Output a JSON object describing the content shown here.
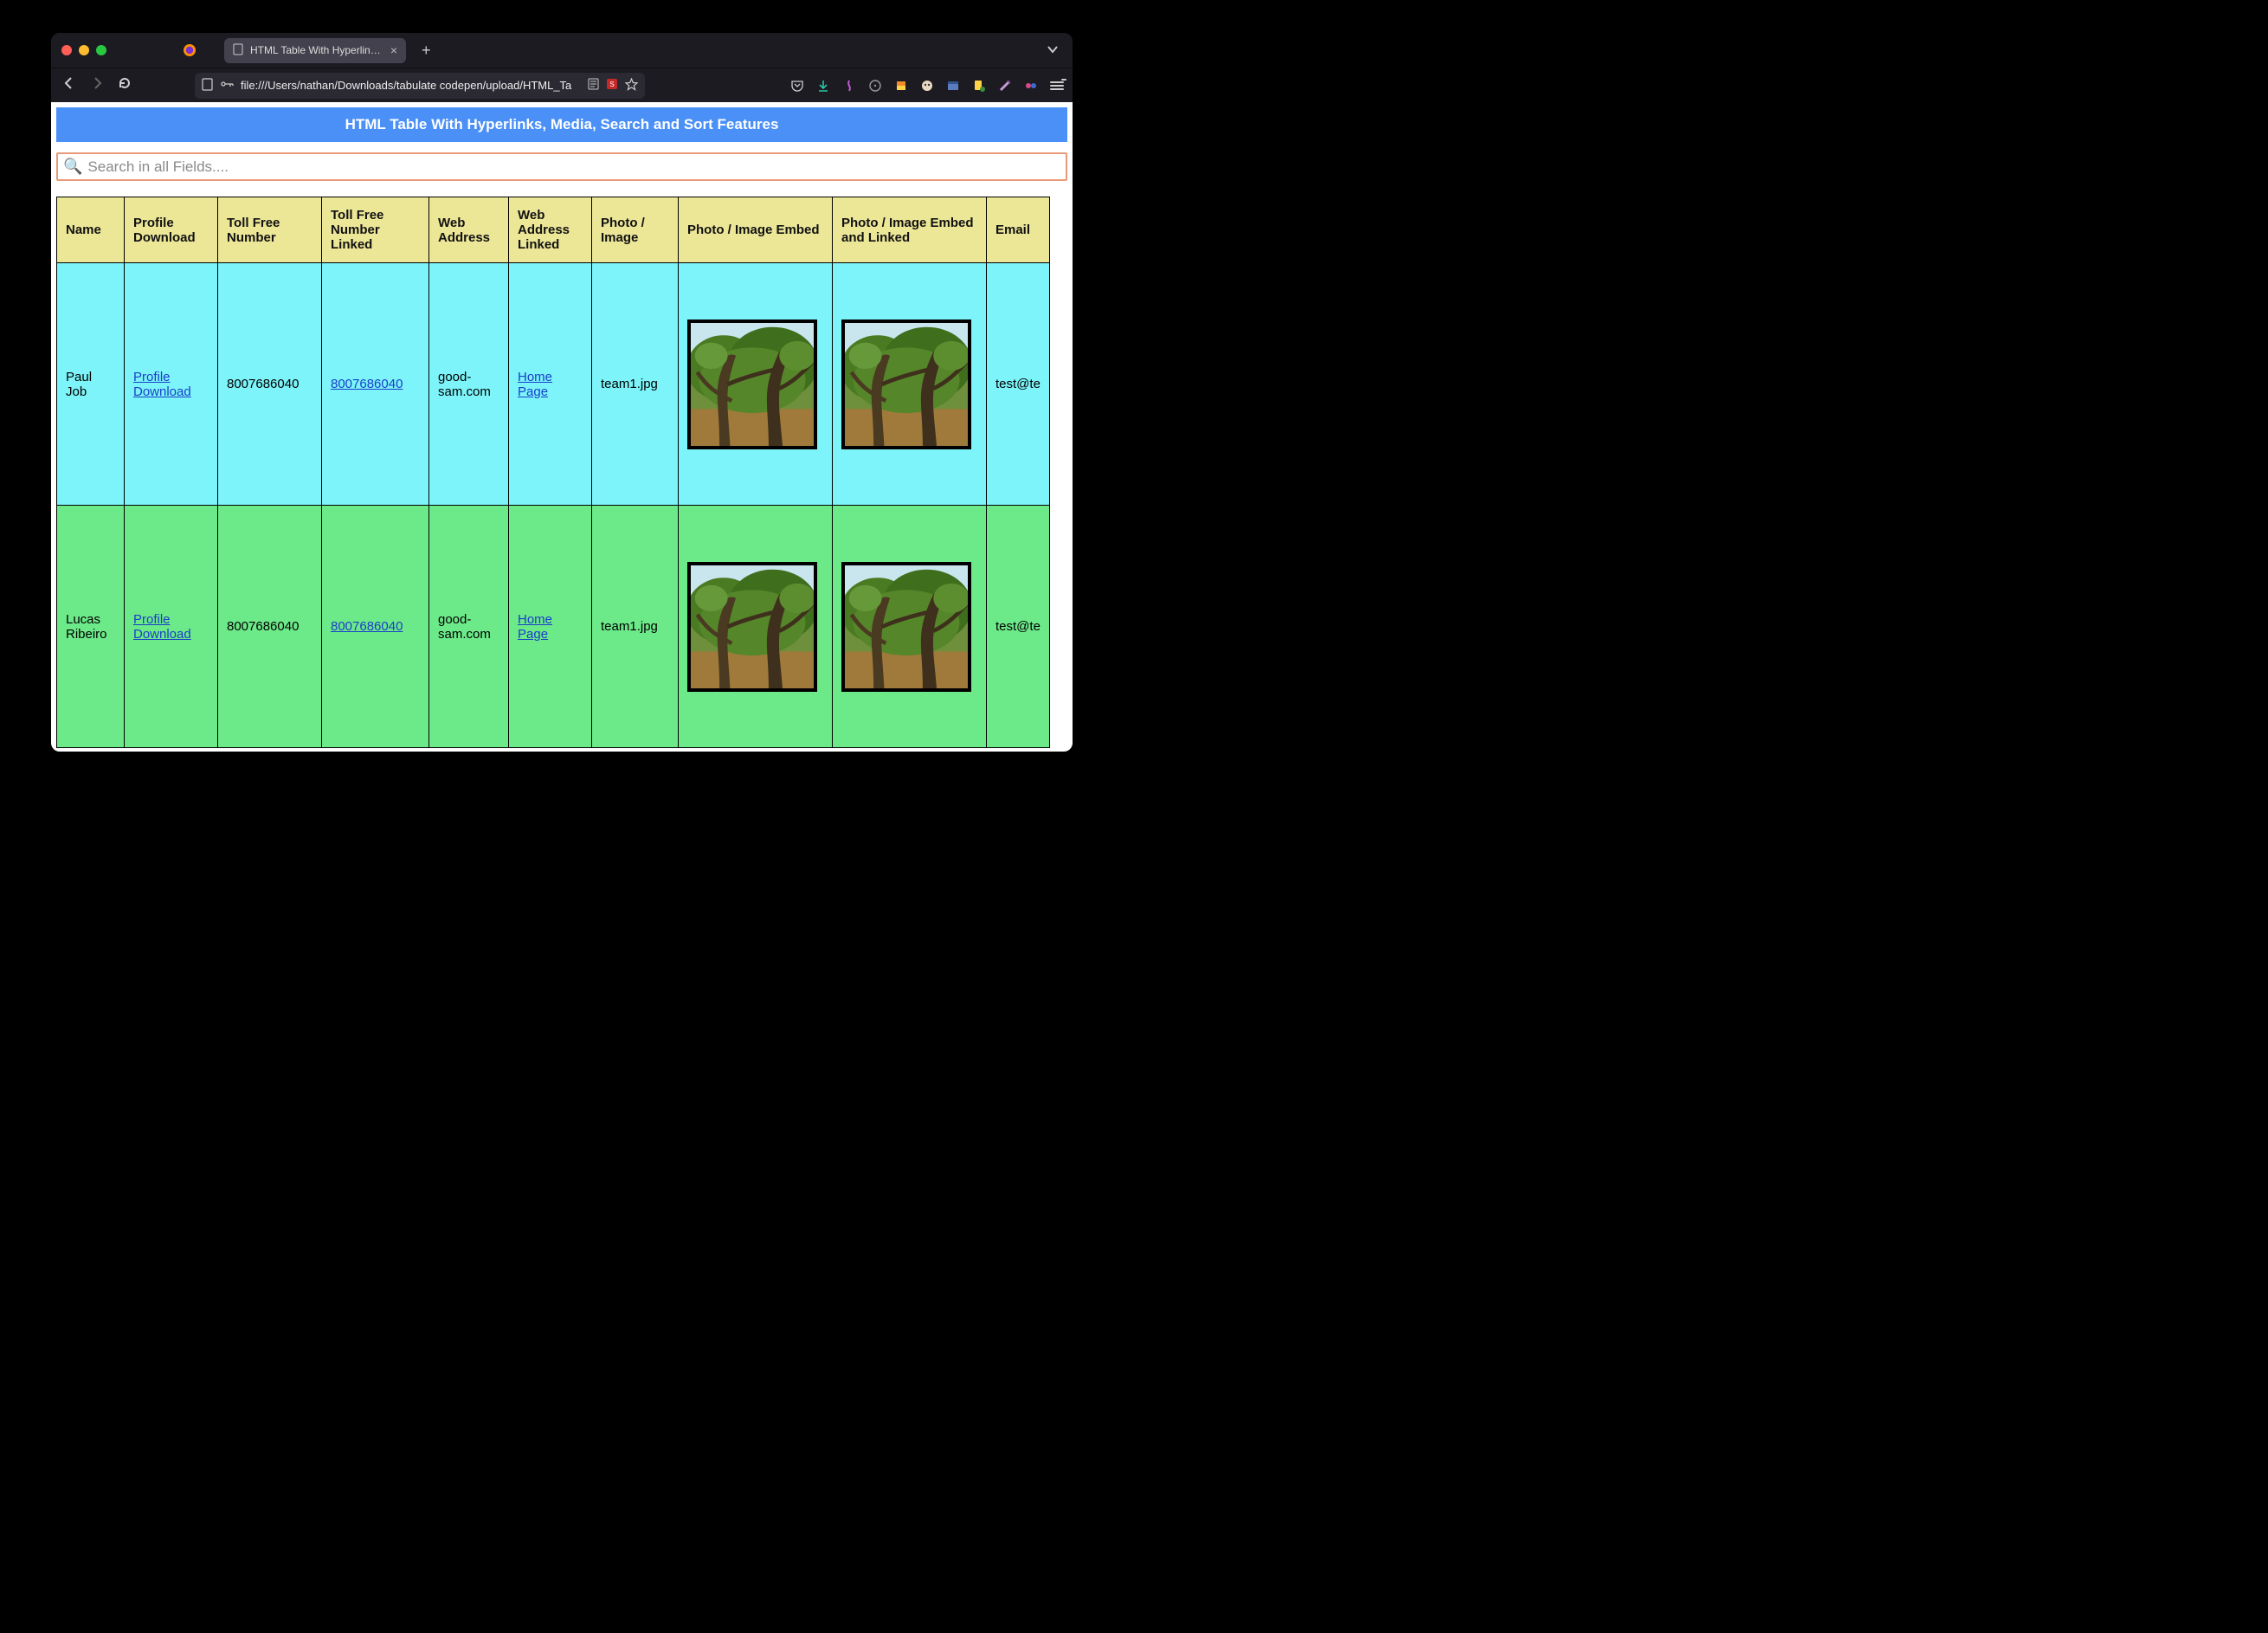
{
  "browser": {
    "tab_title": "HTML Table With Hyperlinks, Media,",
    "url": "file:///Users/nathan/Downloads/tabulate codepen/upload/HTML_Ta"
  },
  "page": {
    "title": "HTML Table With Hyperlinks, Media, Search and Sort Features",
    "search_placeholder": "Search in all Fields...."
  },
  "columns": [
    "Name",
    "Profile Download",
    "Toll Free Number",
    "Toll Free Number Linked",
    "Web Address",
    "Web Address Linked",
    "Photo / Image",
    "Photo / Image Embed",
    "Photo / Image Embed and Linked",
    "Email"
  ],
  "rows": [
    {
      "name": "Paul Job",
      "profile_download": "Profile Download",
      "toll_free": "8007686040",
      "toll_free_linked": "8007686040",
      "web_address": "good-sam.com",
      "web_address_linked": "Home Page",
      "photo_image": "team1.jpg",
      "email": "test@te",
      "row_class": "row-cyan"
    },
    {
      "name": "Lucas Ribeiro",
      "profile_download": "Profile Download",
      "toll_free": "8007686040",
      "toll_free_linked": "8007686040",
      "web_address": "good-sam.com",
      "web_address_linked": "Home Page",
      "photo_image": "team1.jpg",
      "email": "test@te",
      "row_class": "row-green"
    }
  ]
}
